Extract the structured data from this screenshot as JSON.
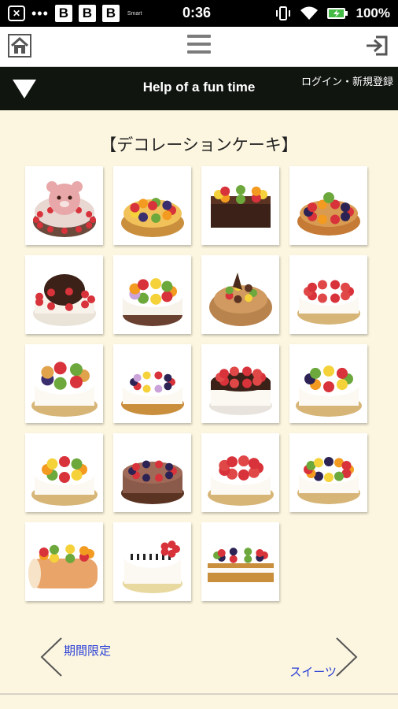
{
  "status_bar": {
    "time": "0:36",
    "battery": "100%",
    "notification_letters": [
      "B",
      "B",
      "B"
    ],
    "dots": "•••",
    "small_text": "Smart"
  },
  "header": {
    "title": "Help of a fun time",
    "login_label": "ログイン・新規登録"
  },
  "section": {
    "title": "【デコレーションケーキ】"
  },
  "cakes": [
    {
      "name": "bear-face-cake",
      "style": "bear"
    },
    {
      "name": "fruit-tart",
      "style": "fruit-tart"
    },
    {
      "name": "chocolate-fruit-bar",
      "style": "choco-bar"
    },
    {
      "name": "berry-tart",
      "style": "berry-tart"
    },
    {
      "name": "chocolate-berry-cake",
      "style": "choco-dome"
    },
    {
      "name": "macaron-fruit-cake",
      "style": "macaron"
    },
    {
      "name": "mont-blanc-cake",
      "style": "montblanc"
    },
    {
      "name": "strawberry-shortcake",
      "style": "shortcake"
    },
    {
      "name": "cream-puff-cake",
      "style": "cream-puff"
    },
    {
      "name": "mixed-berry-cake",
      "style": "mixed-berry"
    },
    {
      "name": "chocolate-drip-strawberry-cake",
      "style": "drip"
    },
    {
      "name": "kiwi-fruit-cake",
      "style": "kiwi"
    },
    {
      "name": "tropical-fruit-cake",
      "style": "tropical"
    },
    {
      "name": "chocolate-strawberry-cake",
      "style": "choco-straw"
    },
    {
      "name": "strawberry-cream-cake",
      "style": "straw-cream"
    },
    {
      "name": "fruit-ring-cake",
      "style": "fruit-ring"
    },
    {
      "name": "fruit-roll-cake",
      "style": "roll"
    },
    {
      "name": "piano-cake",
      "style": "piano"
    },
    {
      "name": "strawberry-napoleon",
      "style": "napoleon"
    }
  ],
  "nav": {
    "prev_label": "期間限定",
    "next_label": "スイーツ"
  },
  "colors": {
    "background": "#fcf6e0",
    "header_bg": "#101510",
    "link": "#2a3fd6"
  }
}
